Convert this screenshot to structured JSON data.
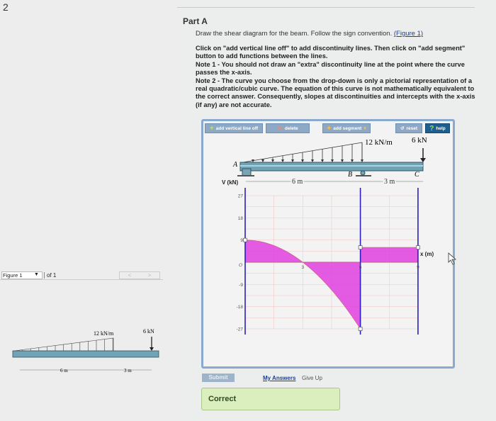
{
  "question_number": "2",
  "part_title": "Part A",
  "intro_text": "Draw the shear diagram for the beam. Follow the sign convention.",
  "figure_link": "(Figure 1)",
  "instructions": [
    "Click on \"add vertical line off\" to add discontinuity lines. Then click on \"add segment\" button to add functions between the lines.",
    "Note 1 - You should not draw an \"extra\" discontinuity line at the point where the curve passes the x-axis.",
    "Note 2 - The curve you choose from the drop-down is only a pictorial representation of a real quadratic/cubic curve. The equation of this curve is not mathematically equivalent to the correct answer. Consequently, slopes at discontinuities and intercepts with the x-axis (if any) are not accurate."
  ],
  "toolbar": {
    "add_vertical_line": "add vertical line off",
    "delete": "delete",
    "add_segment": "add segment",
    "reset": "reset",
    "help": "help"
  },
  "beam": {
    "load_label": "12 kN/m",
    "point_load_label": "6 kN",
    "support_a": "A",
    "support_b": "B",
    "point_c": "C",
    "span_ab": "6 m",
    "span_bc": "3 m"
  },
  "chart_data": {
    "type": "line",
    "ylabel": "V (kN)",
    "xlabel": "x (m)",
    "origin_label": "O",
    "y_ticks": [
      "27",
      "18",
      "9",
      "-9",
      "-18",
      "-27"
    ],
    "x_ticks": [
      "3",
      "6",
      "9"
    ],
    "xlim": [
      0,
      9
    ],
    "ylim": [
      -27,
      27
    ],
    "discontinuity_lines": [
      0,
      6,
      9
    ],
    "segments": [
      {
        "x_start": 0,
        "x_end": 6,
        "shape": "quadratic",
        "v_start": 9,
        "v_end": -27,
        "zero_crossing": 3
      },
      {
        "x_start": 6,
        "x_end": 9,
        "shape": "constant",
        "v_start": 6,
        "v_end": 6
      }
    ],
    "fill_color": "#e040e0",
    "line_color": "#2a1fc0"
  },
  "figure_panel": {
    "selector": "Figure 1",
    "of_label": "of 1",
    "prev": "<",
    "next": ">"
  },
  "actions": {
    "submit": "Submit",
    "my_answers": "My Answers",
    "give_up": "Give Up"
  },
  "feedback": "Correct"
}
